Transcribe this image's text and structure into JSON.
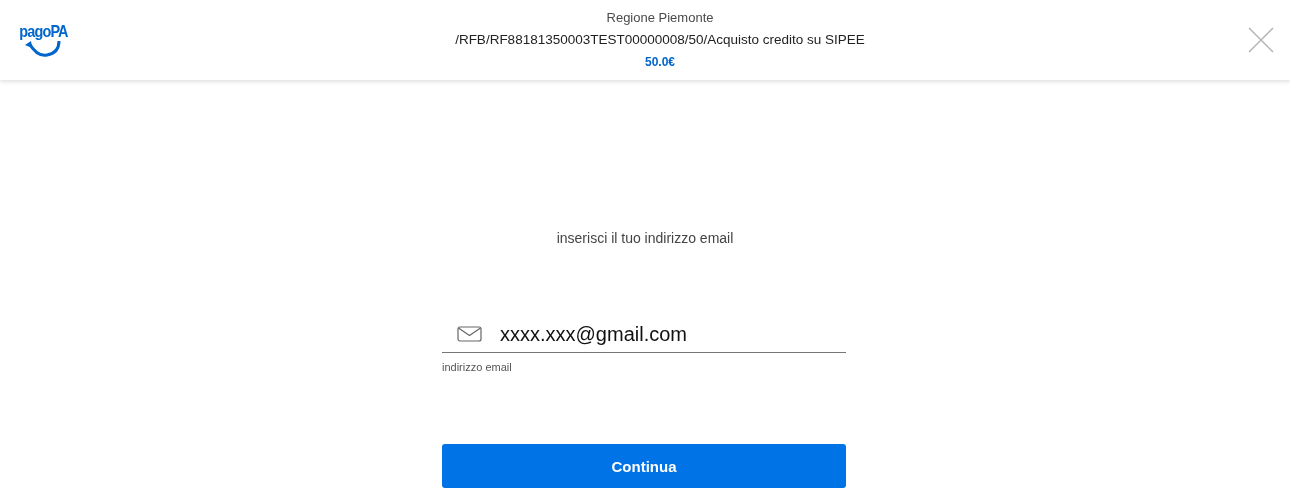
{
  "header": {
    "logo": "pagoPA",
    "payee": "Regione Piemonte",
    "description": "/RFB/RF88181350003TEST00000008/50/Acquisto credito su SIPEE",
    "amount": "50.0€"
  },
  "form": {
    "prompt": "inserisci il tuo indirizzo email",
    "email_field": {
      "value": "xxxx.xxx@gmail.com",
      "helper": "indirizzo email"
    },
    "button": "Continua"
  }
}
